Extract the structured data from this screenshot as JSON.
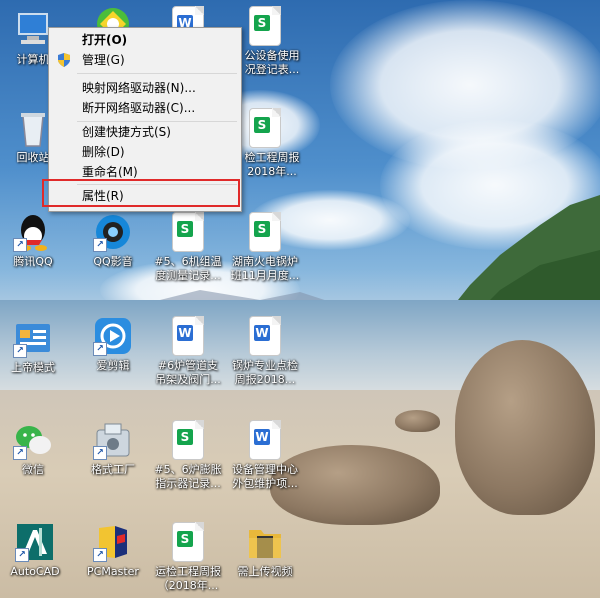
{
  "context_menu": {
    "items": [
      {
        "label": "打开(O)"
      },
      {
        "label": "管理(G)"
      },
      {
        "label": "映射网络驱动器(N)..."
      },
      {
        "label": "断开网络驱动器(C)..."
      },
      {
        "label": "创建快捷方式(S)"
      },
      {
        "label": "删除(D)"
      },
      {
        "label": "重命名(M)"
      },
      {
        "label": "属性(R)"
      }
    ],
    "highlight_color": "#e02a2a"
  },
  "desktop": {
    "icons": [
      {
        "label": "计算机",
        "icon": "computer-icon"
      },
      {
        "label": "回收站",
        "icon": "recycle-bin-icon"
      },
      {
        "label": "腾讯QQ",
        "icon": "qq-icon"
      },
      {
        "label": "上帝模式",
        "icon": "god-mode-icon"
      },
      {
        "label": "微信",
        "icon": "wechat-icon"
      },
      {
        "label": "AutoCAD",
        "icon": "autocad-icon"
      },
      {
        "label": "",
        "icon": "360-security-icon"
      },
      {
        "label": "QQ影音",
        "icon": "qq-player-icon"
      },
      {
        "label": "爱剪辑",
        "icon": "video-editor-icon"
      },
      {
        "label": "格式工厂",
        "icon": "format-factory-icon"
      },
      {
        "label": "PCMaster",
        "icon": "pcmaster-icon"
      },
      {
        "label": "",
        "icon": "word-doc-icon"
      },
      {
        "label": "#5、6机组温\n度测量记录...",
        "icon": "spreadsheet-icon"
      },
      {
        "label": "#6炉管道支\n吊架及阀门...",
        "icon": "word-doc-icon"
      },
      {
        "label": "#5、6炉膨胀\n指示器记录...",
        "icon": "spreadsheet-icon"
      },
      {
        "label": "运检工程周报\n（2018年...",
        "icon": "spreadsheet-icon"
      },
      {
        "label": "公设备使用\n况登记表...",
        "icon": "spreadsheet-icon"
      },
      {
        "label": "检工程周报\n2018年...",
        "icon": "spreadsheet-icon"
      },
      {
        "label": "湖南火电锅炉\n班11月月度...",
        "icon": "spreadsheet-icon"
      },
      {
        "label": "锅炉专业点检\n周报2018...",
        "icon": "word-doc-icon"
      },
      {
        "label": "设备管理中心\n外包维护项...",
        "icon": "word-doc-icon"
      },
      {
        "label": "需上传视频",
        "icon": "folder-icon"
      }
    ]
  },
  "colors": {
    "spreadsheet": "#14a44d",
    "word": "#2b6ed3",
    "folder": "#e8b83b"
  }
}
